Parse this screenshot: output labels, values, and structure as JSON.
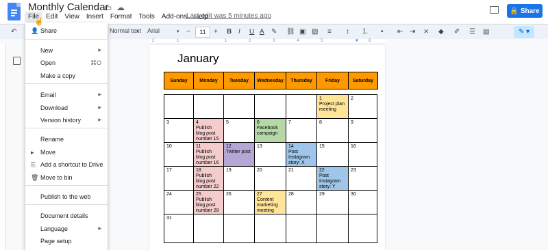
{
  "app": {
    "doc_title": "Monthly Calendar",
    "last_edit": "Last edit was 5 minutes ago",
    "share_label": "Share",
    "menus": [
      "File",
      "Edit",
      "View",
      "Insert",
      "Format",
      "Tools",
      "Add-ons",
      "Help"
    ]
  },
  "toolbar": {
    "style": "Normal text",
    "font": "Arial",
    "font_size": "11",
    "minus": "−",
    "plus": "+",
    "bold": "B",
    "italic": "I",
    "underline": "U",
    "text_color": "A"
  },
  "file_menu": {
    "items": [
      {
        "label": "Share",
        "icon": "person-add-icon"
      },
      {
        "label": "New",
        "submenu": true
      },
      {
        "label": "Open",
        "shortcut": "⌘O"
      },
      {
        "label": "Make a copy"
      },
      {
        "label": "Email",
        "submenu": true
      },
      {
        "label": "Download",
        "submenu": true
      },
      {
        "label": "Version history",
        "submenu": true
      },
      {
        "label": "Rename"
      },
      {
        "label": "Move",
        "icon": "folder-move-icon"
      },
      {
        "label": "Add a shortcut to Drive",
        "icon": "drive-shortcut-icon"
      },
      {
        "label": "Move to bin",
        "icon": "trash-icon"
      },
      {
        "label": "Publish to the web"
      },
      {
        "label": "Document details"
      },
      {
        "label": "Language",
        "submenu": true
      },
      {
        "label": "Page setup"
      }
    ]
  },
  "calendar": {
    "month": "January",
    "days": [
      "Sunday",
      "Monday",
      "Tuesday",
      "Wednesday",
      "Thursday",
      "Friday",
      "Saturday"
    ],
    "header_color": "#ff9900",
    "weeks": [
      [
        {
          "d": ""
        },
        {
          "d": ""
        },
        {
          "d": ""
        },
        {
          "d": ""
        },
        {
          "d": ""
        },
        {
          "d": "1",
          "ev": "Project plan meeting",
          "color": "#ffe599"
        },
        {
          "d": "2"
        }
      ],
      [
        {
          "d": "3"
        },
        {
          "d": "4",
          "ev": "Publish blog post number 15",
          "color": "#f4cccc"
        },
        {
          "d": "5"
        },
        {
          "d": "6",
          "ev": "Facebook campaign",
          "color": "#b6d7a8"
        },
        {
          "d": "7"
        },
        {
          "d": "8"
        },
        {
          "d": "9"
        }
      ],
      [
        {
          "d": "10"
        },
        {
          "d": "11",
          "ev": "Publish blog post number 16",
          "color": "#f4cccc"
        },
        {
          "d": "12",
          "ev": "Twitter post",
          "color": "#b4a7d6"
        },
        {
          "d": "13"
        },
        {
          "d": "14",
          "ev": "Post Instagram story: X",
          "color": "#9fc5e8"
        },
        {
          "d": "15"
        },
        {
          "d": "16"
        }
      ],
      [
        {
          "d": "17"
        },
        {
          "d": "18",
          "ev": "Publish blog post number 22",
          "color": "#f4cccc"
        },
        {
          "d": "19"
        },
        {
          "d": "20"
        },
        {
          "d": "21"
        },
        {
          "d": "22",
          "ev": "Post Instagram story: Y",
          "color": "#9fc5e8"
        },
        {
          "d": "23"
        }
      ],
      [
        {
          "d": "24"
        },
        {
          "d": "25",
          "ev": "Publish blog post number 28",
          "color": "#f4cccc"
        },
        {
          "d": "26"
        },
        {
          "d": "27",
          "ev": "Content marketing meeting",
          "color": "#ffe599"
        },
        {
          "d": "28"
        },
        {
          "d": "29"
        },
        {
          "d": "30"
        }
      ],
      [
        {
          "d": "31"
        },
        {
          "d": ""
        },
        {
          "d": ""
        },
        {
          "d": ""
        },
        {
          "d": ""
        },
        {
          "d": ""
        },
        {
          "d": ""
        }
      ]
    ]
  }
}
